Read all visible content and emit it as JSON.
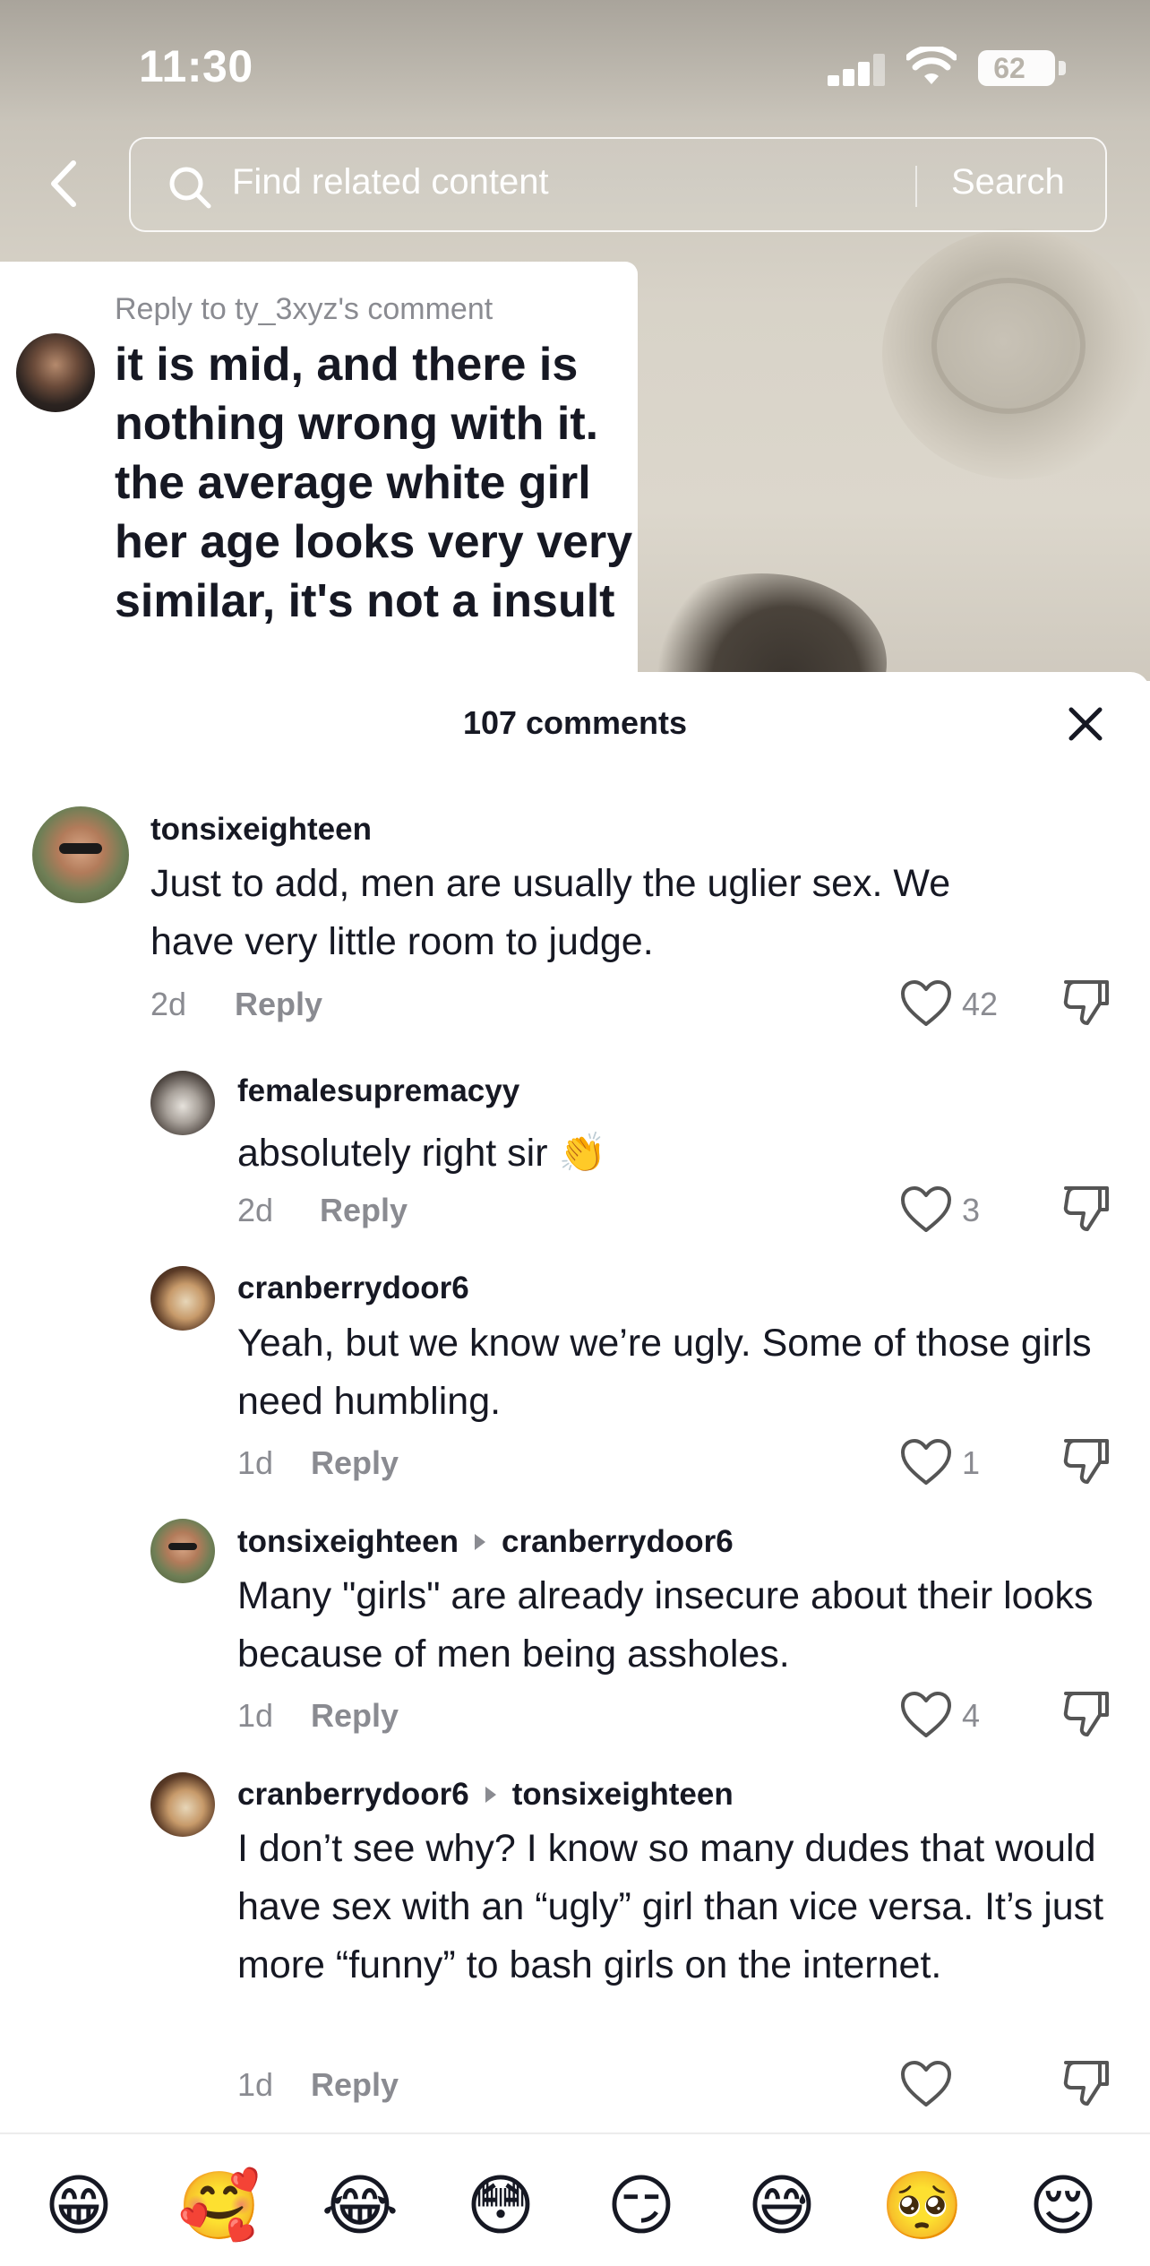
{
  "status_bar": {
    "time": "11:30",
    "battery": "62"
  },
  "search": {
    "placeholder": "Find related content",
    "button": "Search"
  },
  "sticker": {
    "reply_to": "Reply to ty_3xyz's comment",
    "text": "it is mid, and there is nothing wrong with it. the average white girl her age looks very very similar, it's not a insult"
  },
  "sheet": {
    "title": "107 comments"
  },
  "comments": [
    {
      "user": "tonsixeighteen",
      "reply_to": "",
      "text": "Just to add, men are usually the uglier sex. We have very little room to judge.",
      "time": "2d",
      "reply_label": "Reply",
      "likes": "42"
    },
    {
      "user": "femalesupremacyy",
      "reply_to": "",
      "text": "absolutely right sir 👏",
      "time": "2d",
      "reply_label": "Reply",
      "likes": "3"
    },
    {
      "user": "cranberrydoor6",
      "reply_to": "",
      "text": "Yeah, but we know we’re ugly. Some of those girls need humbling.",
      "time": "1d",
      "reply_label": "Reply",
      "likes": "1"
    },
    {
      "user": "tonsixeighteen",
      "reply_to": "cranberrydoor6",
      "text": "Many \"girls\" are already insecure about their looks because of men being assholes.",
      "time": "1d",
      "reply_label": "Reply",
      "likes": "4"
    },
    {
      "user": "cranberrydoor6",
      "reply_to": "tonsixeighteen",
      "text": "I don’t see why? I know so many dudes that would have sex with an “ugly” girl than vice versa. It’s just more “funny” to bash girls on the internet.",
      "time": "1d",
      "reply_label": "Reply",
      "likes": ""
    }
  ],
  "emojis": [
    "😁",
    "🥰",
    "😂",
    "😳",
    "😏",
    "😅",
    "🥺",
    "😌"
  ],
  "icons": {
    "back": "chevron-left-icon",
    "search": "search-icon",
    "close": "close-icon",
    "like": "heart-outline-icon",
    "dislike": "thumbs-down-icon"
  }
}
